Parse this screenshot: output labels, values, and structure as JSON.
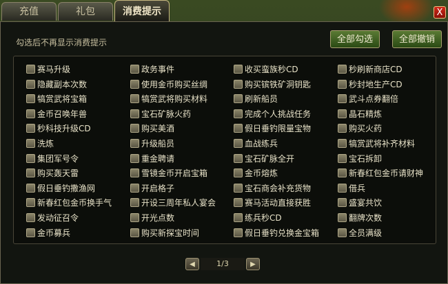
{
  "tabs": [
    {
      "label": "充值"
    },
    {
      "label": "礼包"
    },
    {
      "label": "消费提示"
    }
  ],
  "close_glyph": "X",
  "hint_text": "勾选后不再显示消费提示",
  "buttons": {
    "select_all": "全部勾选",
    "deselect_all": "全部撤销"
  },
  "columns": [
    [
      "赛马升级",
      "隐藏副本次数",
      "犒赏武将宝箱",
      "金币召唤年兽",
      "秒科技升级CD",
      "洗炼",
      "集团军号令",
      "购买轰天雷",
      "假日垂钓撒渔网",
      "新春红包金币换手气",
      "发动征召令",
      "金币募兵"
    ],
    [
      "政务事件",
      "使用金币购买丝绸",
      "犒赏武将购买材料",
      "宝石矿脉火药",
      "购买美酒",
      "升级船员",
      "重金聘请",
      "雪镜金币开启宝箱",
      "开启格子",
      "开设三周年私人宴会",
      "开光点数",
      "购买新探宝时间"
    ],
    [
      "收买蛮族秒CD",
      "购买镔铁矿洞钥匙",
      "刷新船员",
      "完成个人挑战任务",
      "假日垂钓限量宝物",
      "血战练兵",
      "宝石矿脉全开",
      "金币熔炼",
      "宝石商会补充货物",
      "赛马活动直接获胜",
      "练兵秒CD",
      "假日垂钓兑换金宝箱"
    ],
    [
      "秒刷新商店CD",
      "秒封地生产CD",
      "武斗点券翻倍",
      "晶石精炼",
      "购买火药",
      "犒赏武将补齐材料",
      "宝石拆卸",
      "新春红包金币请财神",
      "借兵",
      "盛宴共饮",
      "翻牌次数",
      "全员满级"
    ]
  ],
  "pager": {
    "prev_glyph": "◀",
    "next_glyph": "▶",
    "page_text": "1/3"
  }
}
